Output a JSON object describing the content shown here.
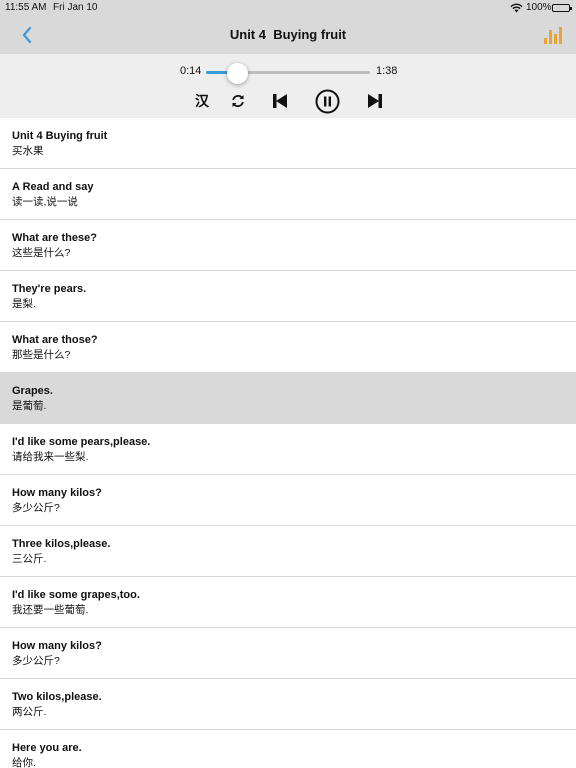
{
  "status_bar": {
    "time": "11:55 AM",
    "date": "Fri Jan 10",
    "battery": "100%"
  },
  "nav": {
    "title": "Unit 4  Buying fruit",
    "back_icon": "chevron-left-icon",
    "levels_icon": "bar-chart-icon",
    "accent_color": "#3d9ad8",
    "levels_color": "#e8a33a"
  },
  "player": {
    "current_time": "0:14",
    "total_time": "1:38",
    "progress": 0.19,
    "lang_toggle_label": "汉"
  },
  "sentences": [
    {
      "en": "Unit 4 Buying fruit",
      "zh": "买水果"
    },
    {
      "en": "A Read and say",
      "zh": "读一读,说一说"
    },
    {
      "en": "What are these?",
      "zh": "这些是什么?"
    },
    {
      "en": "They're pears.",
      "zh": "是梨."
    },
    {
      "en": "What are those?",
      "zh": "那些是什么?"
    },
    {
      "en": "Grapes.",
      "zh": "是葡萄.",
      "active": true
    },
    {
      "en": "I'd like some pears,please.",
      "zh": "请给我来一些梨."
    },
    {
      "en": "How many kilos?",
      "zh": "多少公斤?"
    },
    {
      "en": "Three kilos,please.",
      "zh": "三公斤."
    },
    {
      "en": "I'd like some grapes,too.",
      "zh": "我还要一些葡萄."
    },
    {
      "en": "How many kilos?",
      "zh": "多少公斤?"
    },
    {
      "en": "Two kilos,please.",
      "zh": "两公斤."
    },
    {
      "en": "Here you are.",
      "zh": "给你."
    }
  ]
}
